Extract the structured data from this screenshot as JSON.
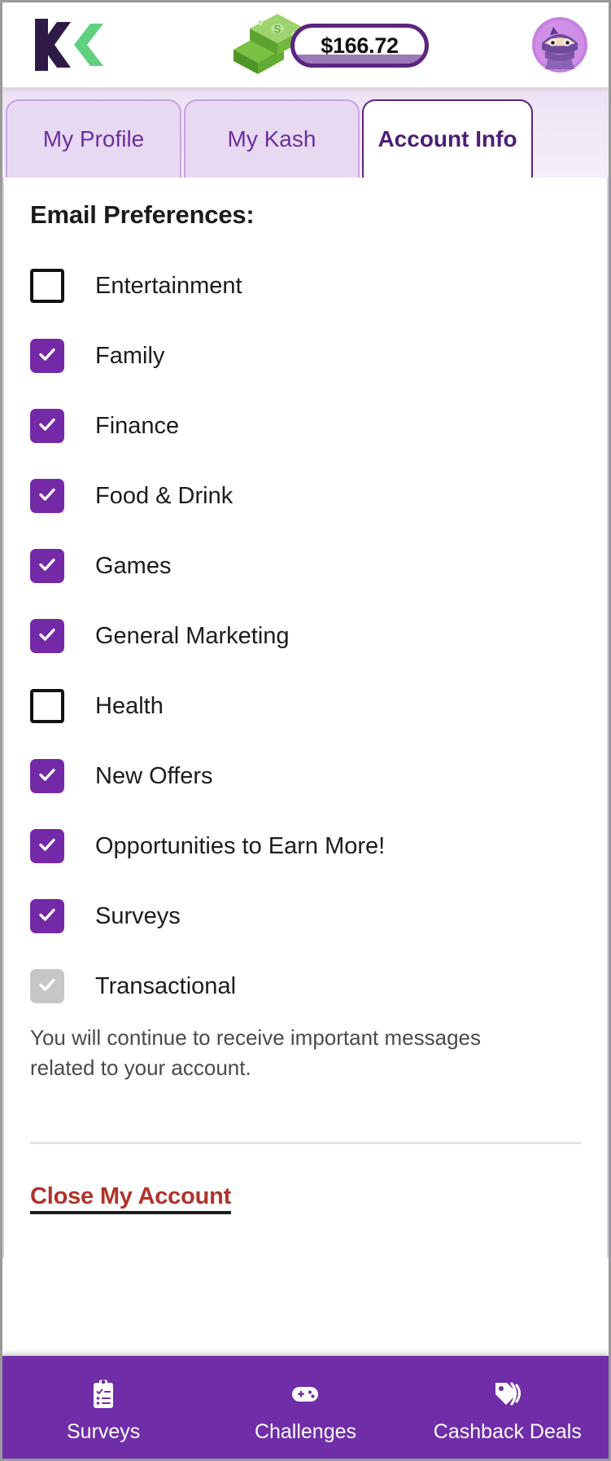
{
  "header": {
    "logo_name": "kashkick-logo",
    "money_icon": "cash-stack-icon",
    "balance": "$166.72",
    "avatar_name": "ninja-avatar"
  },
  "tabs": [
    {
      "label": "My Profile",
      "active": false
    },
    {
      "label": "My Kash",
      "active": false
    },
    {
      "label": "Account Info",
      "active": true
    }
  ],
  "main": {
    "section_title": "Email Preferences:",
    "preferences": [
      {
        "label": "Entertainment",
        "state": "off"
      },
      {
        "label": "Family",
        "state": "on"
      },
      {
        "label": "Finance",
        "state": "on"
      },
      {
        "label": "Food & Drink",
        "state": "on"
      },
      {
        "label": "Games",
        "state": "on"
      },
      {
        "label": "General Marketing",
        "state": "on"
      },
      {
        "label": "Health",
        "state": "off"
      },
      {
        "label": "New Offers",
        "state": "on"
      },
      {
        "label": "Opportunities to Earn More!",
        "state": "on"
      },
      {
        "label": "Surveys",
        "state": "on"
      },
      {
        "label": "Transactional",
        "state": "disabled"
      }
    ],
    "transactional_note": "You will continue to receive important messages related to your account.",
    "close_account_label": "Close My Account"
  },
  "bottom_nav": [
    {
      "label": "Surveys",
      "icon": "clipboard-checklist-icon"
    },
    {
      "label": "Challenges",
      "icon": "gamepad-icon"
    },
    {
      "label": "Cashback Deals",
      "icon": "price-tags-icon"
    }
  ],
  "colors": {
    "brand_purple": "#6f2da8",
    "checkbox_purple": "#7429a6",
    "tab_active_border": "#5b2480",
    "danger_red": "#b0332a",
    "logo_green": "#5fd17f",
    "logo_dark": "#2e1a47"
  }
}
